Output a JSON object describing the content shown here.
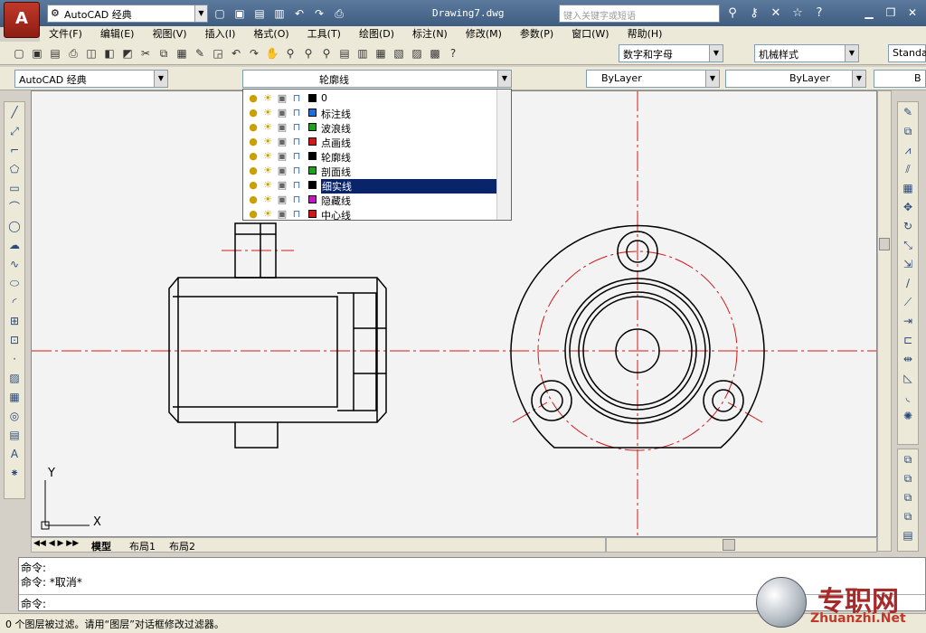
{
  "window": {
    "workspace": "AutoCAD 经典",
    "doc_title": "Drawing7.dwg",
    "search_placeholder": "键入关键字或短语"
  },
  "menu": [
    "文件(F)",
    "编辑(E)",
    "视图(V)",
    "插入(I)",
    "格式(O)",
    "工具(T)",
    "绘图(D)",
    "标注(N)",
    "修改(M)",
    "参数(P)",
    "窗口(W)",
    "帮助(H)"
  ],
  "toolbar": {
    "text_style": "数字和字母",
    "dim_style": "机械样式",
    "table_style": "Standa",
    "workspace2": "AutoCAD 经典",
    "current_layer": "轮廓线",
    "color": "ByLayer",
    "linetype": "ByLayer",
    "lineweight": "B"
  },
  "layers": [
    {
      "name": "0",
      "color": "#000000"
    },
    {
      "name": "标注线",
      "color": "#1f6fd6"
    },
    {
      "name": "波浪线",
      "color": "#1ea01e"
    },
    {
      "name": "点画线",
      "color": "#d01818"
    },
    {
      "name": "轮廓线",
      "color": "#000000"
    },
    {
      "name": "剖面线",
      "color": "#1ea01e"
    },
    {
      "name": "细实线",
      "color": "#000000"
    },
    {
      "name": "隐藏线",
      "color": "#c018c0"
    },
    {
      "name": "中心线",
      "color": "#d01818"
    }
  ],
  "selected_layer": "细实线",
  "tabs": [
    "模型",
    "布局1",
    "布局2"
  ],
  "ucs": {
    "x": "X",
    "y": "Y"
  },
  "command": {
    "line1": "命令:",
    "line2": "命令: *取消*",
    "prompt": "命令:"
  },
  "status": "0 个图层被过滤。请用“图层”对话框修改过滤器。",
  "watermark": {
    "text": "专职网",
    "url": "Zhuanzhi.Net"
  }
}
